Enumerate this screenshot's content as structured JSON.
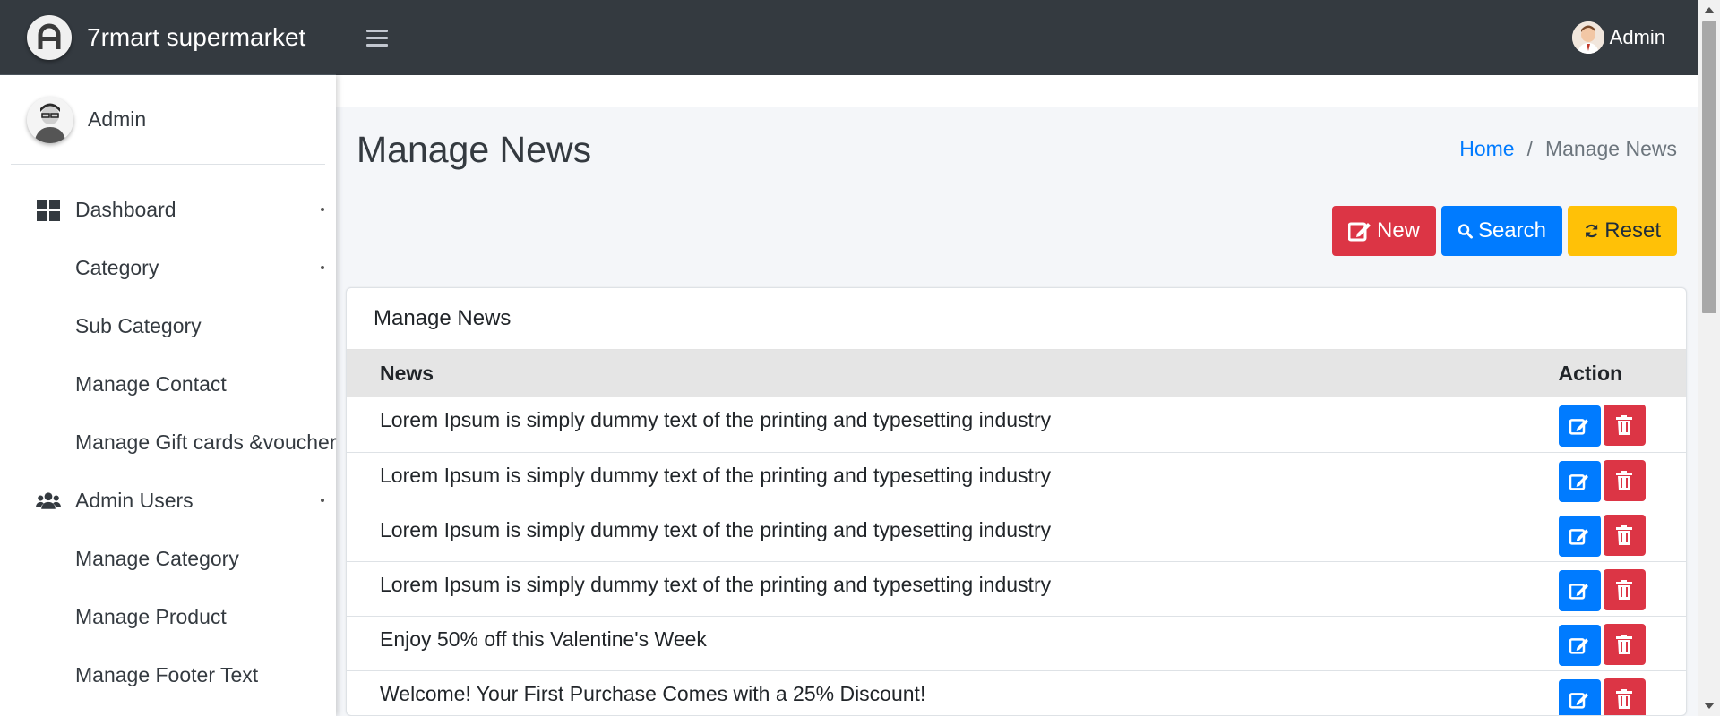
{
  "brand": {
    "name": "7rmart supermarket",
    "logo_icon": "logo-a-icon"
  },
  "navbar": {
    "menu_icon": "hamburger-icon",
    "user_name": "Admin"
  },
  "sidebar": {
    "user_name": "Admin",
    "items": [
      {
        "label": "Dashboard",
        "icon": "dashboard-icon",
        "caret": true
      },
      {
        "label": "Category",
        "icon": "",
        "caret": true
      },
      {
        "label": "Sub Category",
        "icon": "",
        "caret": false
      },
      {
        "label": "Manage Contact",
        "icon": "",
        "caret": false
      },
      {
        "label": "Manage Gift cards &voucher",
        "icon": "",
        "caret": false
      },
      {
        "label": "Admin Users",
        "icon": "users-icon",
        "caret": true
      },
      {
        "label": "Manage Category",
        "icon": "",
        "caret": false
      },
      {
        "label": "Manage Product",
        "icon": "",
        "caret": false
      },
      {
        "label": "Manage Footer Text",
        "icon": "",
        "caret": false
      }
    ]
  },
  "page": {
    "title": "Manage News",
    "breadcrumb": {
      "home": "Home",
      "separator": "/",
      "current": "Manage News"
    }
  },
  "toolbar": {
    "new_label": "New",
    "search_label": "Search",
    "reset_label": "Reset"
  },
  "card": {
    "title": "Manage News",
    "columns": {
      "news": "News",
      "action": "Action"
    },
    "rows": [
      "Lorem Ipsum is simply dummy text of the printing and typesetting industry",
      "Lorem Ipsum is simply dummy text of the printing and typesetting industry",
      "Lorem Ipsum is simply dummy text of the printing and typesetting industry",
      "Lorem Ipsum is simply dummy text of the printing and typesetting industry",
      "Enjoy 50% off this Valentine's Week",
      "Welcome! Your First Purchase Comes with a 25% Discount!"
    ]
  },
  "colors": {
    "navbar": "#343a40",
    "primary": "#007bff",
    "danger": "#dc3545",
    "warning": "#ffc107"
  }
}
